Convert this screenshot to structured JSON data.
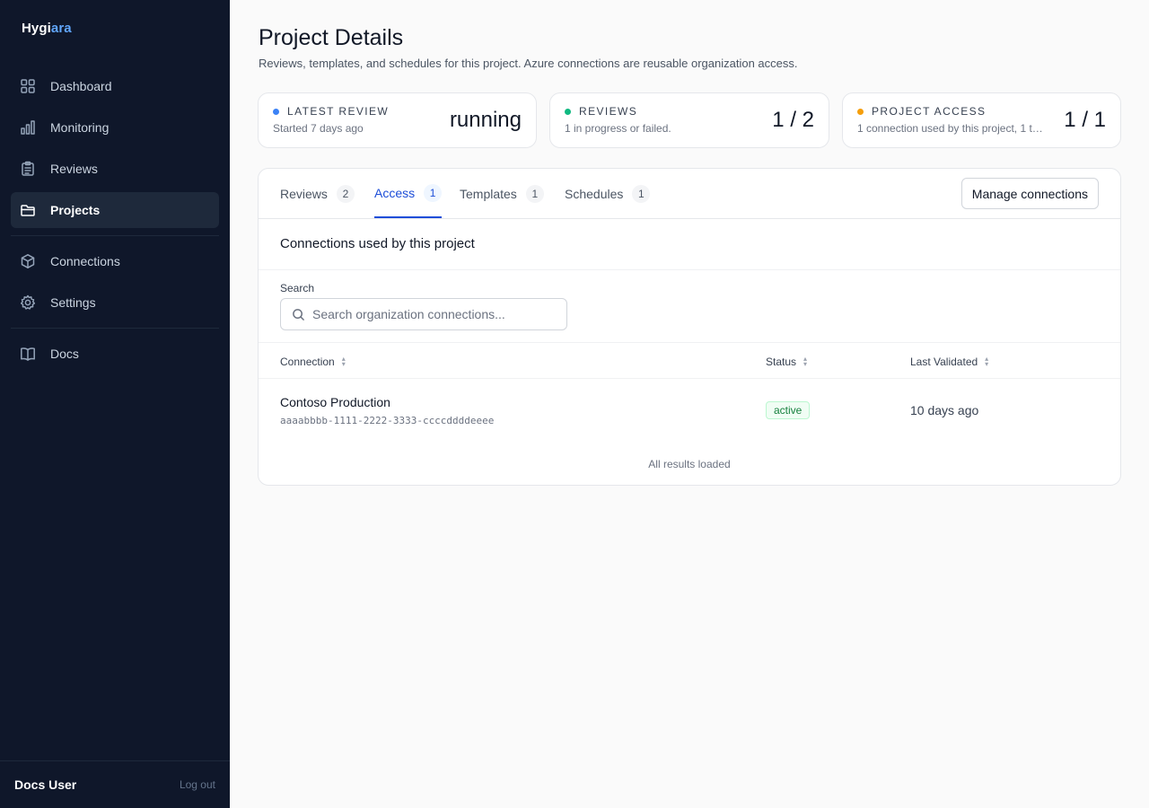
{
  "sidebar": {
    "brand_main": "Hygi",
    "brand_accent": "ara",
    "items": [
      {
        "label": "Dashboard",
        "icon": "grid-icon"
      },
      {
        "label": "Monitoring",
        "icon": "bar-chart-icon"
      },
      {
        "label": "Reviews",
        "icon": "clipboard-icon"
      },
      {
        "label": "Projects",
        "icon": "folder-icon",
        "active": true
      },
      {
        "label": "Connections",
        "icon": "cube-icon"
      },
      {
        "label": "Settings",
        "icon": "gear-icon"
      },
      {
        "label": "Docs",
        "icon": "book-icon"
      }
    ],
    "user_name": "Docs User",
    "logout_label": "Log out"
  },
  "header": {
    "title": "Project Details",
    "subtitle": "Reviews, templates, and schedules for this project. Azure connections are reusable organization access."
  },
  "stats": [
    {
      "label": "Latest Review",
      "sub": "Started 7 days ago",
      "value": "running",
      "dot_color": "#3b82f6"
    },
    {
      "label": "Reviews",
      "sub": "1 in progress or failed.",
      "value": "1 / 2",
      "dot_color": "#10b981"
    },
    {
      "label": "Project Access",
      "sub": "1 connection used by this project, 1 te...",
      "value": "1 / 1",
      "dot_color": "#f59e0b"
    }
  ],
  "tabs": [
    {
      "label": "Reviews",
      "count": "2"
    },
    {
      "label": "Access",
      "count": "1",
      "active": true
    },
    {
      "label": "Templates",
      "count": "1"
    },
    {
      "label": "Schedules",
      "count": "1"
    }
  ],
  "manage_button": "Manage connections",
  "section": {
    "title": "Connections used by this project",
    "search_label": "Search",
    "search_placeholder": "Search organization connections..."
  },
  "table": {
    "headers": [
      "Connection",
      "Status",
      "Last Validated"
    ],
    "rows": [
      {
        "name": "Contoso Production",
        "id": "aaaabbbb-1111-2222-3333-ccccddddeeee",
        "status": "active",
        "last_validated": "10 days ago"
      }
    ],
    "footer": "All results loaded"
  },
  "colors": {
    "sidebar_bg": "#0f172a",
    "accent": "#1d4ed8",
    "status_active": "#15803d"
  }
}
